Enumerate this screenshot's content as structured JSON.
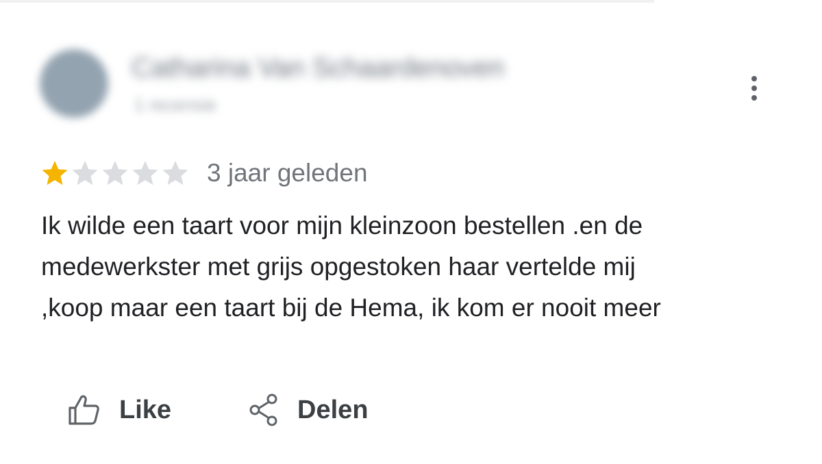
{
  "review": {
    "author": {
      "name": "Catharina Van Schaardenoven",
      "meta": "1 recensie"
    },
    "rating": {
      "value": 1,
      "max": 5,
      "filled_color": "#f4b400",
      "empty_color": "#dadce0"
    },
    "time": "3 jaar geleden",
    "text_lines": [
      "Ik wilde een taart voor mijn kleinzoon bestellen .en de",
      "medewerkster met grijs opgestoken haar vertelde mij",
      ",koop maar een taart bij de Hema, ik kom er nooit meer"
    ],
    "actions": {
      "like_label": "Like",
      "share_label": "Delen"
    },
    "icons": {
      "more": "more-vert-icon",
      "like": "thumb-up-icon",
      "share": "share-icon"
    }
  }
}
